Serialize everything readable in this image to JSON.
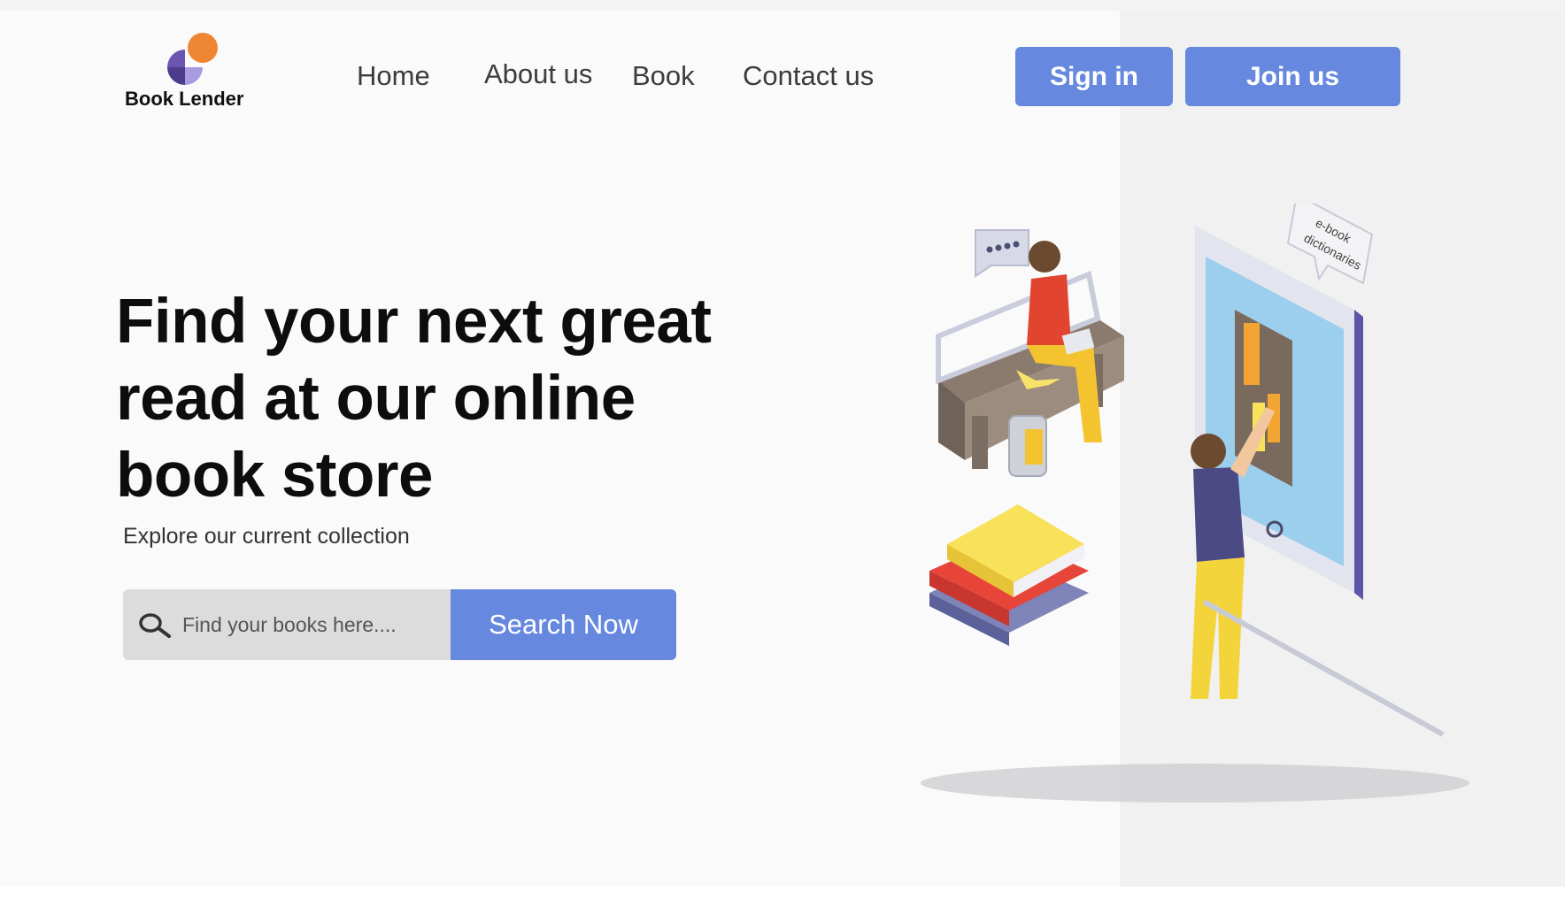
{
  "brand": {
    "name": "Book Lender",
    "colors": {
      "orange": "#ee8633",
      "purple": "#5b4a9b",
      "lilac": "#9b8fd6"
    }
  },
  "nav": {
    "items": [
      {
        "label": "Home"
      },
      {
        "label": "About us"
      },
      {
        "label": "Book"
      },
      {
        "label": "Contact us"
      }
    ]
  },
  "auth": {
    "sign_in": "Sign in",
    "join": "Join us"
  },
  "hero": {
    "headline": "Find your next great read at our online book store",
    "subtitle": "Explore our current collection"
  },
  "search": {
    "placeholder": "Find your books here....",
    "button": "Search Now",
    "icon": "search-icon"
  },
  "illustration": {
    "badge_line1": "e-book",
    "badge_line2": "dictionaries"
  },
  "colors": {
    "accent": "#6688de",
    "panel": "#f1f1f2"
  }
}
